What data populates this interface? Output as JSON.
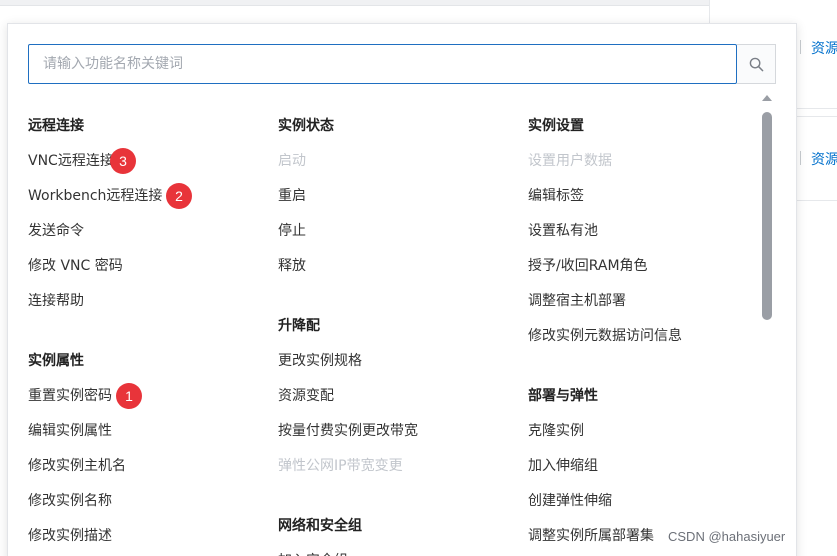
{
  "background": {
    "resource_link_1": "资源",
    "resource_link_2": "资源"
  },
  "search": {
    "placeholder": "请输入功能名称关键词",
    "value": "",
    "button_icon": "search-icon"
  },
  "columns": [
    {
      "groups": [
        {
          "title": "远程连接",
          "items": [
            {
              "label": "VNC远程连接",
              "disabled": false,
              "badge": "3"
            },
            {
              "label": "Workbench远程连接",
              "disabled": false,
              "badge": "2"
            },
            {
              "label": "发送命令",
              "disabled": false
            },
            {
              "label": "修改 VNC 密码",
              "disabled": false
            },
            {
              "label": "连接帮助",
              "disabled": false
            }
          ]
        },
        {
          "title": "实例属性",
          "items": [
            {
              "label": "重置实例密码",
              "disabled": false,
              "badge": "1"
            },
            {
              "label": "编辑实例属性",
              "disabled": false
            },
            {
              "label": "修改实例主机名",
              "disabled": false
            },
            {
              "label": "修改实例名称",
              "disabled": false
            },
            {
              "label": "修改实例描述",
              "disabled": false
            }
          ]
        }
      ]
    },
    {
      "groups": [
        {
          "title": "实例状态",
          "items": [
            {
              "label": "启动",
              "disabled": true
            },
            {
              "label": "重启",
              "disabled": false
            },
            {
              "label": "停止",
              "disabled": false
            },
            {
              "label": "释放",
              "disabled": false
            }
          ]
        },
        {
          "title": "升降配",
          "items": [
            {
              "label": "更改实例规格",
              "disabled": false
            },
            {
              "label": "资源变配",
              "disabled": false
            },
            {
              "label": "按量付费实例更改带宽",
              "disabled": false
            },
            {
              "label": "弹性公网IP带宽变更",
              "disabled": true
            }
          ]
        },
        {
          "title": "网络和安全组",
          "items": [
            {
              "label": "加入安全组",
              "disabled": false
            }
          ]
        }
      ]
    },
    {
      "groups": [
        {
          "title": "实例设置",
          "items": [
            {
              "label": "设置用户数据",
              "disabled": true
            },
            {
              "label": "编辑标签",
              "disabled": false
            },
            {
              "label": "设置私有池",
              "disabled": false
            },
            {
              "label": "授予/收回RAM角色",
              "disabled": false
            },
            {
              "label": "调整宿主机部署",
              "disabled": false
            },
            {
              "label": "修改实例元数据访问信息",
              "disabled": false
            }
          ]
        },
        {
          "title": "部署与弹性",
          "items": [
            {
              "label": "克隆实例",
              "disabled": false
            },
            {
              "label": "加入伸缩组",
              "disabled": false
            },
            {
              "label": "创建弹性伸缩",
              "disabled": false
            },
            {
              "label": "调整实例所属部署集",
              "disabled": false
            }
          ]
        }
      ]
    }
  ],
  "watermark": "CSDN @hahasiyuer"
}
